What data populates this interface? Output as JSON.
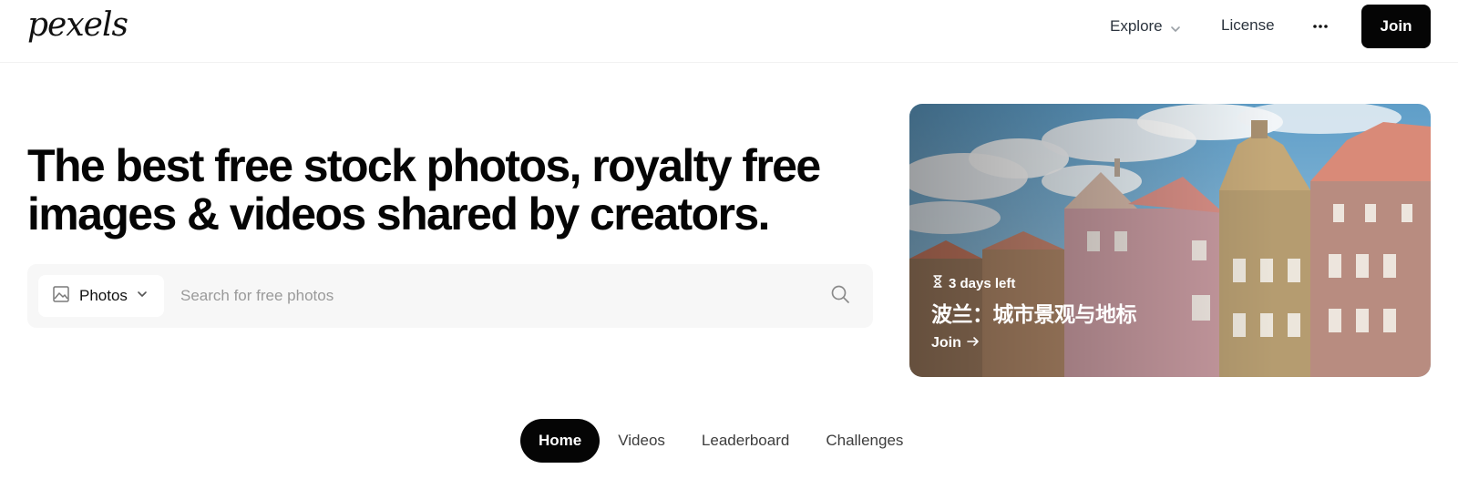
{
  "header": {
    "logo": "pexels",
    "nav": {
      "explore": "Explore",
      "license": "License",
      "more": "···",
      "join": "Join"
    }
  },
  "hero": {
    "title_line1": "The best free stock photos, royalty free",
    "title_line2": "images & videos shared by creators."
  },
  "search": {
    "type_selected": "Photos",
    "placeholder": "Search for free photos",
    "icons": {
      "type": "image-icon",
      "chevron": "chevron-down-icon",
      "search": "search-icon"
    }
  },
  "promo": {
    "time_left": "3 days left",
    "title": "波兰：城市景观与地标",
    "cta": "Join",
    "icons": {
      "time": "hourglass-icon",
      "arrow": "arrow-right-icon"
    }
  },
  "tabs": [
    {
      "label": "Home",
      "active": true
    },
    {
      "label": "Videos",
      "active": false
    },
    {
      "label": "Leaderboard",
      "active": false
    },
    {
      "label": "Challenges",
      "active": false
    }
  ],
  "colors": {
    "text_dark": "#050505",
    "text": "#2c343e",
    "search_bg": "#f7f7f7",
    "button_bg": "#050505",
    "button_text": "#ffffff"
  }
}
